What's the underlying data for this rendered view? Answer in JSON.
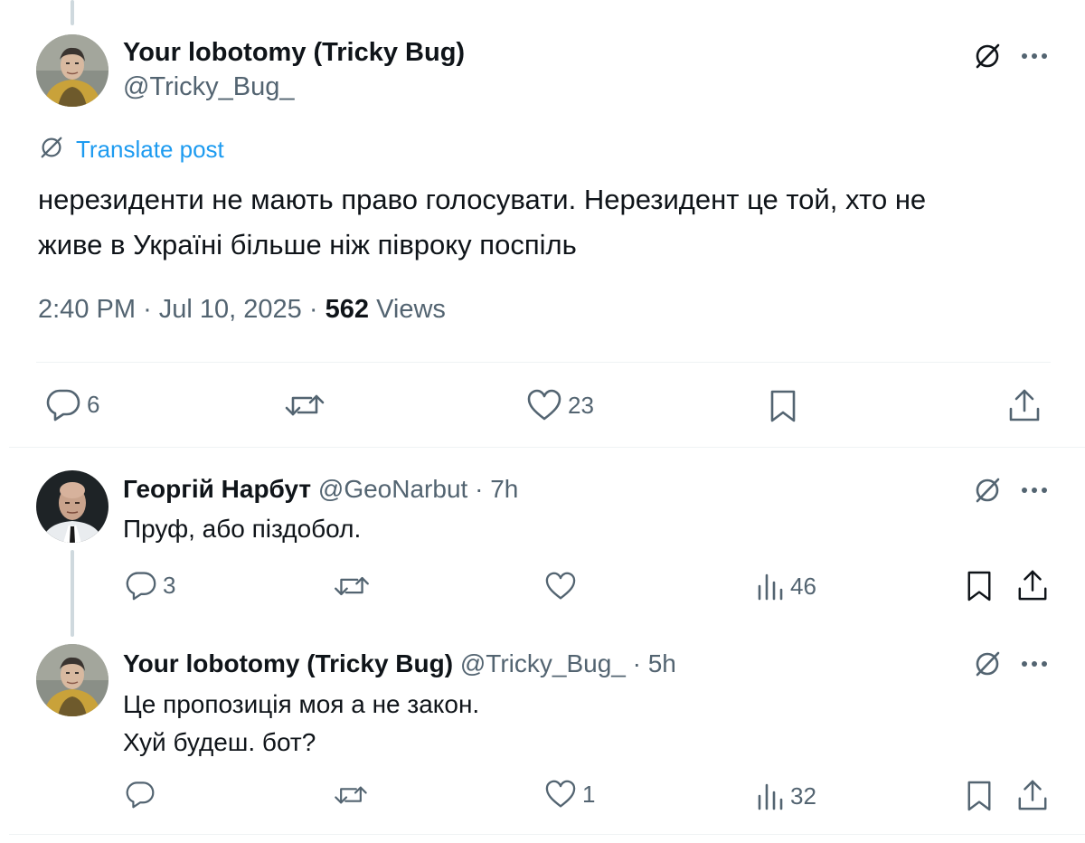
{
  "main_post": {
    "author_name": "Your lobotomy (Tricky Bug)",
    "author_handle": "@Tricky_Bug_",
    "translate_label": "Translate post",
    "text_line1": "нерезиденти не мають право голосувати. Нерезидент це той, хто не",
    "text_line2": "живе в Україні більше ніж півроку поспіль",
    "time": "2:40 PM",
    "dot1": "·",
    "date": "Jul 10, 2025",
    "dot2": "·",
    "views_count": "562",
    "views_label": "Views",
    "replies": "6",
    "likes": "23"
  },
  "replies": [
    {
      "author_name": "Георгій Нарбут",
      "author_handle": "@GeoNarbut",
      "dot": "·",
      "time": "7h",
      "text_lines": [
        "Пруф, або піздобол."
      ],
      "replies": "3",
      "views": "46"
    },
    {
      "author_name": "Your lobotomy (Tricky Bug)",
      "author_handle": "@Tricky_Bug_",
      "dot": "·",
      "time": "5h",
      "text_lines": [
        "Це пропозиція моя а не закон.",
        "Хуй будеш. бот?"
      ],
      "likes": "1",
      "views": "32"
    }
  ],
  "icons": {
    "translate": "translate-icon",
    "more": "more-icon",
    "reply": "reply-icon",
    "repost": "repost-icon",
    "like": "like-icon",
    "bookmark": "bookmark-icon",
    "share": "share-icon",
    "views": "views-icon"
  },
  "colors": {
    "link": "#1d9bf0",
    "muted": "#536471",
    "text": "#0f1419",
    "divider": "#eff3f4"
  }
}
